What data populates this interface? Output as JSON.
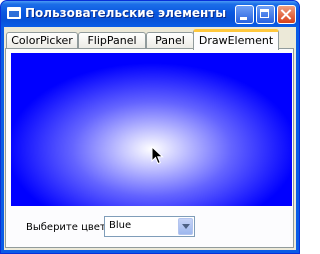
{
  "window": {
    "title": "Пользовательские элементы"
  },
  "tabs": [
    {
      "label": "ColorPicker"
    },
    {
      "label": "FlipPanel"
    },
    {
      "label": "Panel"
    },
    {
      "label": "DrawElement"
    }
  ],
  "active_tab": "DrawElement",
  "draw_element": {
    "gradient_center_color": "#ffffff",
    "gradient_edge_color": "#0000ff"
  },
  "color_picker": {
    "label": "Выберите цвет:",
    "selected": "Blue"
  },
  "colors": {
    "title_bar": "#0a58e0",
    "active_tab_accent": "#ffc83c",
    "dialog_background": "#ece9d8"
  }
}
